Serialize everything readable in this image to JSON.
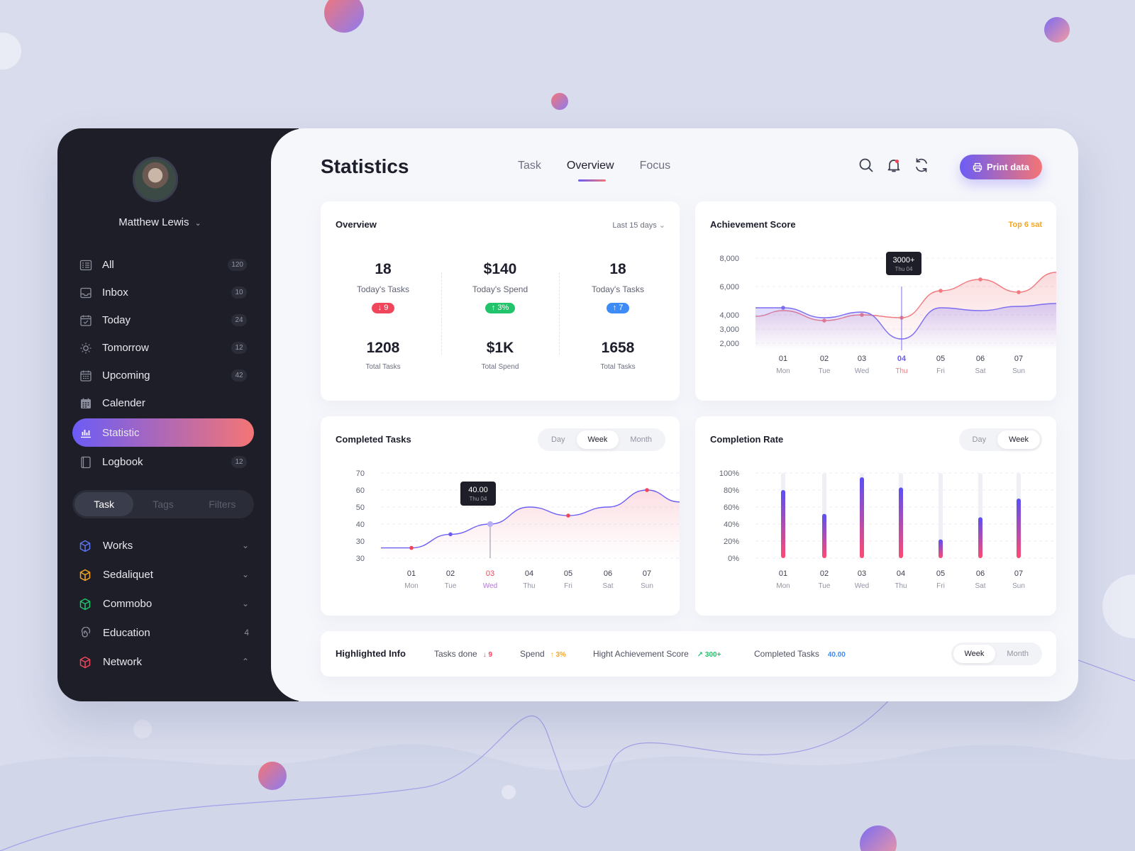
{
  "colors": {
    "accent_start": "#6b5cf6",
    "accent_end": "#f47575",
    "red": "#f0465c",
    "green": "#21c46b",
    "blue": "#3d8bf5",
    "orange": "#f5a623"
  },
  "user": {
    "name": "Matthew Lewis"
  },
  "nav": [
    {
      "label": "All",
      "badge": "120",
      "icon": "list-icon"
    },
    {
      "label": "Inbox",
      "badge": "10",
      "icon": "inbox-icon"
    },
    {
      "label": "Today",
      "badge": "24",
      "icon": "calendar-check-icon"
    },
    {
      "label": "Tomorrow",
      "badge": "12",
      "icon": "sun-icon"
    },
    {
      "label": "Upcoming",
      "badge": "42",
      "icon": "calendar-grid-icon"
    },
    {
      "label": "Calender",
      "badge": "",
      "icon": "calendar-icon"
    },
    {
      "label": "Statistic",
      "badge": "",
      "icon": "bar-chart-icon",
      "active": true
    },
    {
      "label": "Logbook",
      "badge": "12",
      "icon": "book-icon"
    }
  ],
  "sidebar_segment": [
    "Task",
    "Tags",
    "Filters"
  ],
  "groups": [
    {
      "label": "Works",
      "right": "chevron-down",
      "color": "#5b74f0"
    },
    {
      "label": "Sedaliquet",
      "right": "chevron-down",
      "color": "#f5a623"
    },
    {
      "label": "Commobo",
      "right": "chevron-down",
      "color": "#21c46b"
    },
    {
      "label": "Education",
      "right": "4",
      "color": "#8a8c9b"
    },
    {
      "label": "Network",
      "right": "chevron-up",
      "color": "#f0465c"
    }
  ],
  "header": {
    "title": "Statistics",
    "tabs": [
      "Task",
      "Overview",
      "Focus"
    ],
    "active_tab": "Overview",
    "print_label": "Print data"
  },
  "overview": {
    "title": "Overview",
    "range": "Last 15 days",
    "stats": [
      {
        "value": "18",
        "label": "Today's Tasks",
        "delta": "↓ 9",
        "delta_color": "#f0465c",
        "total": "1208",
        "total_label": "Total Tasks"
      },
      {
        "value": "$140",
        "label": "Today's Spend",
        "delta": "↑ 3%",
        "delta_color": "#21c46b",
        "total": "$1K",
        "total_label": "Total Spend"
      },
      {
        "value": "18",
        "label": "Today's Tasks",
        "delta": "↑ 7",
        "delta_color": "#3d8bf5",
        "total": "1658",
        "total_label": "Total Tasks"
      }
    ]
  },
  "achievement": {
    "title": "Achievement Score",
    "badge": "Top 6 sat",
    "tooltip_value": "3000+",
    "tooltip_sub": "Thu 04"
  },
  "completed": {
    "title": "Completed Tasks",
    "segments": [
      "Day",
      "Week",
      "Month"
    ],
    "active": "Week",
    "tooltip_value": "40.00",
    "tooltip_sub": "Thu 04"
  },
  "completion_rate": {
    "title": "Completion Rate",
    "segments": [
      "Day",
      "Week"
    ],
    "active": "Week"
  },
  "highlighted": {
    "title": "Highlighted Info",
    "items": [
      {
        "label": "Tasks done",
        "value": "↓ 9",
        "color": "#f0465c"
      },
      {
        "label": "Spend",
        "value": "↑ 3%",
        "color": "#f5a623"
      },
      {
        "label": "Hight Achievement Score",
        "value": "↗ 300+",
        "color": "#21c46b"
      },
      {
        "label": "Completed Tasks",
        "value": "40.00",
        "color": "#3d8bf5"
      }
    ],
    "segments": [
      "Week",
      "Month"
    ],
    "active": "Week"
  },
  "chart_data": [
    {
      "type": "area",
      "id": "achievement",
      "title": "Achievement Score",
      "categories": [
        "01",
        "02",
        "03",
        "04",
        "05",
        "06",
        "07"
      ],
      "category_sub": [
        "Mon",
        "Tue",
        "Wed",
        "Thu",
        "Fri",
        "Sat",
        "Sun"
      ],
      "highlight_index": 3,
      "y_ticks": [
        "8,000",
        "6,000",
        "4,000",
        "3,000",
        "2,000"
      ],
      "series": [
        {
          "values": [
            4300,
            3600,
            4000,
            3800,
            5700,
            6500,
            5600
          ],
          "color": "#f07a80"
        },
        {
          "values": [
            4500,
            3800,
            4200,
            2300,
            4500,
            4300,
            4600
          ],
          "color": "#7b6cf2"
        }
      ]
    },
    {
      "type": "area",
      "id": "completed",
      "title": "Completed Tasks",
      "categories": [
        "01",
        "02",
        "03",
        "04",
        "05",
        "06",
        "07"
      ],
      "category_sub": [
        "Mon",
        "Tue",
        "Wed",
        "Thu",
        "Fri",
        "Sat",
        "Sun"
      ],
      "highlight_index": 2,
      "y_ticks": [
        "70",
        "60",
        "50",
        "40",
        "30",
        "30"
      ],
      "series": [
        {
          "values": [
            31,
            39,
            45,
            55,
            50,
            55,
            65
          ],
          "color": "#6b5cf6"
        }
      ]
    },
    {
      "type": "bar",
      "id": "completion",
      "title": "Completion Rate",
      "categories": [
        "01",
        "02",
        "03",
        "04",
        "05",
        "06",
        "07"
      ],
      "category_sub": [
        "Mon",
        "Tue",
        "Wed",
        "Thu",
        "Fri",
        "Sat",
        "Sun"
      ],
      "y_ticks": [
        "100%",
        "80%",
        "60%",
        "40%",
        "20%",
        "0%"
      ],
      "values": [
        80,
        52,
        95,
        83,
        22,
        48,
        70
      ],
      "ylim": [
        0,
        100
      ]
    }
  ]
}
